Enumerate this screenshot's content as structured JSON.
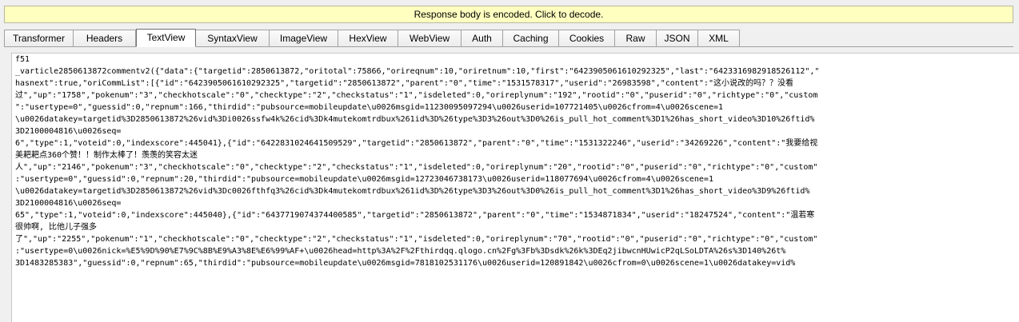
{
  "banner": "Response body is encoded. Click to decode.",
  "tabs": [
    {
      "label": "Transformer",
      "name": "tab-transformer",
      "width": 87
    },
    {
      "label": "Headers",
      "name": "tab-headers",
      "width": 78
    },
    {
      "label": "TextView",
      "name": "tab-textview",
      "width": 75,
      "active": true
    },
    {
      "label": "SyntaxView",
      "name": "tab-syntaxview",
      "width": 92
    },
    {
      "label": "ImageView",
      "name": "tab-imageview",
      "width": 86
    },
    {
      "label": "HexView",
      "name": "tab-hexview",
      "width": 75
    },
    {
      "label": "WebView",
      "name": "tab-webview",
      "width": 79
    },
    {
      "label": "Auth",
      "name": "tab-auth",
      "width": 52
    },
    {
      "label": "Caching",
      "name": "tab-caching",
      "width": 70
    },
    {
      "label": "Cookies",
      "name": "tab-cookies",
      "width": 70
    },
    {
      "label": "Raw",
      "name": "tab-raw",
      "width": 52
    },
    {
      "label": "JSON",
      "name": "tab-json",
      "width": 52
    },
    {
      "label": "XML",
      "name": "tab-xml",
      "width": 52
    }
  ],
  "text_lines": [
    "f51",
    "_varticle2850613872commentv2({\"data\":{\"targetid\":2850613872,\"oritotal\":75866,\"orireqnum\":10,\"oriretnum\":10,\"first\":\"6423905061610292325\",\"last\":\"6423316982918526112\",\"",
    "hasnext\":true,\"oriCommList\":[{\"id\":\"6423905061610292325\",\"targetid\":\"2850613872\",\"parent\":\"0\",\"time\":\"1531578317\",\"userid\":\"26983598\",\"content\":\"这小说改的吗？？没看",
    "过\",\"up\":\"1758\",\"pokenum\":\"3\",\"checkhotscale\":\"0\",\"checktype\":\"2\",\"checkstatus\":\"1\",\"isdeleted\":0,\"orireplynum\":\"192\",\"rootid\":\"0\",\"puserid\":\"0\",\"richtype\":\"0\",\"custom",
    "\":\"usertype=0\",\"guessid\":0,\"repnum\":166,\"thirdid\":\"pubsource=mobileupdate\\u0026msgid=11230095097294\\u0026userid=107721405\\u0026cfrom=4\\u0026scene=1",
    "\\u0026datakey=targetid%3D2850613872%26vid%3Di0026ssfw4k%26cid%3Dk4mutekomtrdbux%261id%3D%26type%3D3%26out%3D0%26is_pull_hot_comment%3D1%26has_short_video%3D10%26ftid%",
    "3D2100004816\\u0026seq=",
    "6\",\"type\":1,\"voteid\":0,\"indexscore\":445041},{\"id\":\"6422831024641509529\",\"targetid\":\"2850613872\",\"parent\":\"0\",\"time\":\"1531322246\",\"userid\":\"34269226\",\"content\":\"我要给视",
    "美耙耙点360个赞！！制作太棒了！羡羡的笑容太迷",
    "人\",\"up\":\"2146\",\"pokenum\":\"3\",\"checkhotscale\":\"0\",\"checktype\":\"2\",\"checkstatus\":\"1\",\"isdeleted\":0,\"orireplynum\":\"20\",\"rootid\":\"0\",\"puserid\":\"0\",\"richtype\":\"0\",\"custom\"",
    ":\"usertype=0\",\"guessid\":0,\"repnum\":20,\"thirdid\":\"pubsource=mobileupdate\\u0026msgid=12723046738173\\u0026userid=118077694\\u0026cfrom=4\\u0026scene=1",
    "\\u0026datakey=targetid%3D2850613872%26vid%3Dc0026fthfq3%26cid%3Dk4mutekomtrdbux%261id%3D%26type%3D3%26out%3D0%26is_pull_hot_comment%3D1%26has_short_video%3D9%26ftid%",
    "3D2100004816\\u0026seq=",
    "65\",\"type\":1,\"voteid\":0,\"indexscore\":445040},{\"id\":\"6437719074374400585\",\"targetid\":\"2850613872\",\"parent\":\"0\",\"time\":\"1534871834\",\"userid\":\"18247524\",\"content\":\"温若寒",
    "很帅啊, 比他儿子强多",
    "了\",\"up\":\"2255\",\"pokenum\":\"1\",\"checkhotscale\":\"0\",\"checktype\":\"2\",\"checkstatus\":\"1\",\"isdeleted\":0,\"orireplynum\":\"70\",\"rootid\":\"0\",\"puserid\":\"0\",\"richtype\":\"0\",\"custom\"",
    ":\"usertype=0\\u0026nick=%E5%9D%90%E7%9C%8B%E9%A3%8E%E6%99%AF+\\u0026head=http%3A%2F%2Fthirdqq.qlogo.cn%2Fg%3Fb%3Dsdk%26k%3DEq2jibwcnHUwicP2qLSoLDTA%26s%3D140%26t%",
    "3D1483285383\",\"guessid\":0,\"repnum\":65,\"thirdid\":\"pubsource=mobileupdate\\u0026msgid=7818102531176\\u0026userid=120891842\\u0026cfrom=0\\u0026scene=1\\u0026datakey=vid%"
  ]
}
